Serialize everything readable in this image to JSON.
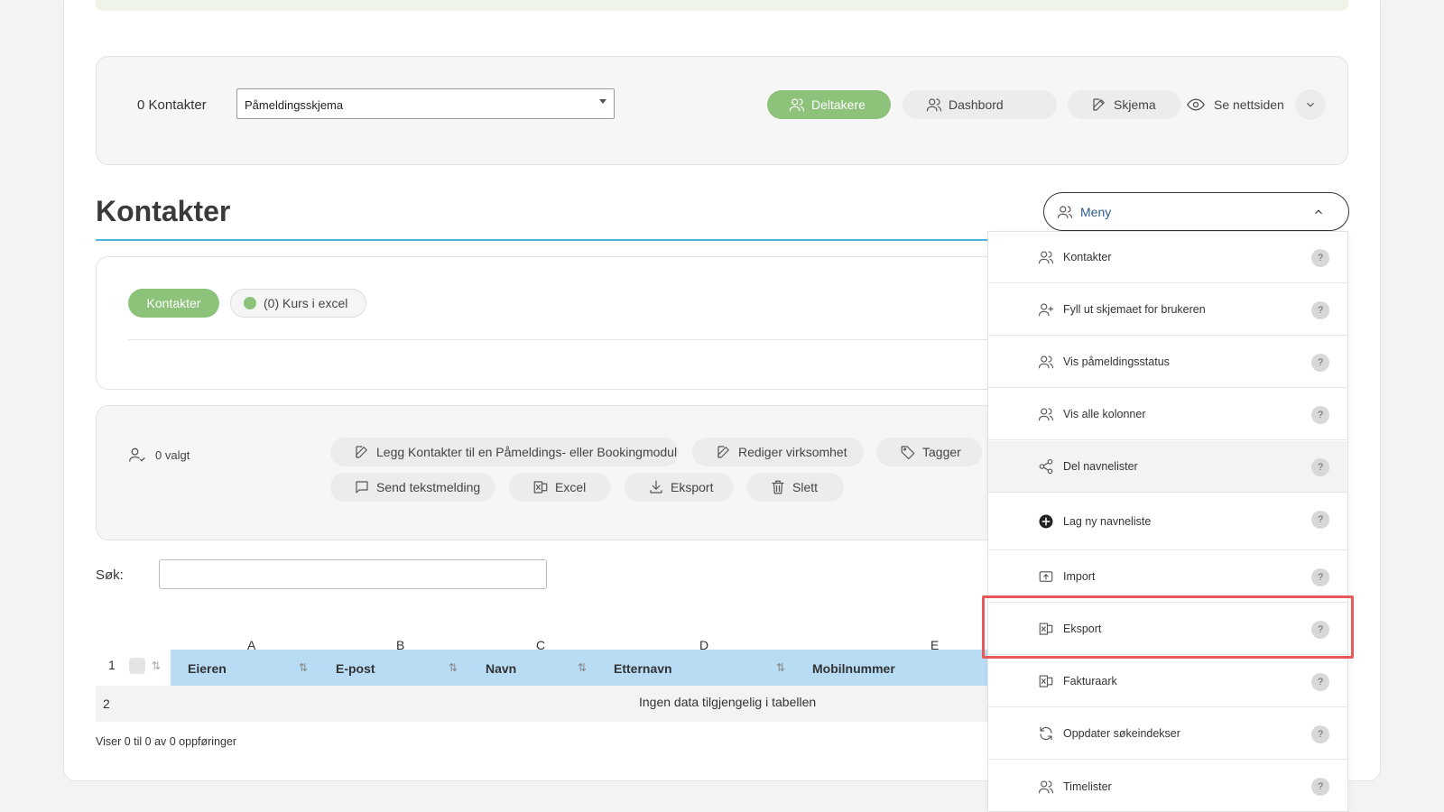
{
  "header": {
    "contacts_count": "0 Kontakter",
    "form_select": "Påmeldingsskjema",
    "tabs": [
      "Deltakere",
      "Dashbord",
      "Skjema"
    ],
    "view_site": "Se nettsiden"
  },
  "page_title": "Kontakter",
  "menu_button": "Meny",
  "pills": {
    "contacts": "Kontakter",
    "excel_list": "(0) Kurs i excel"
  },
  "actions": {
    "selected": "0 valgt",
    "add_to_module": "Legg Kontakter til en Påmeldings- eller Bookingmodul",
    "edit_company": "Rediger virksomhet",
    "tags": "Tagger",
    "send_sms": "Send tekstmelding",
    "excel": "Excel",
    "export": "Eksport",
    "delete": "Slett"
  },
  "search": {
    "label": "Søk:",
    "placeholder": ""
  },
  "table": {
    "col_letters": [
      "A",
      "B",
      "C",
      "D",
      "E"
    ],
    "headers": [
      "Eieren",
      "E-post",
      "Navn",
      "Etternavn",
      "Mobilnummer"
    ],
    "row_numbers": [
      "1",
      "2"
    ],
    "empty_text": "Ingen data tilgjengelig i tabellen",
    "info": "Viser 0 til 0 av 0 oppføringer"
  },
  "dropdown": {
    "items": [
      {
        "label": "Kontakter",
        "icon": "users-icon"
      },
      {
        "label": "Fyll ut skjemaet for brukeren",
        "icon": "user-plus-icon"
      },
      {
        "label": "Vis påmeldingsstatus",
        "icon": "users-icon"
      },
      {
        "label": "Vis alle kolonner",
        "icon": "users-icon"
      },
      {
        "label": "Del navnelister",
        "icon": "share-icon"
      },
      {
        "label": "Lag ny navneliste",
        "icon": "plus-circle-icon"
      },
      {
        "label": "Import",
        "icon": "upload-icon"
      },
      {
        "label": "Eksport",
        "icon": "excel-icon"
      },
      {
        "label": "Fakturaark",
        "icon": "excel-icon"
      },
      {
        "label": "Oppdater søkeindekser",
        "icon": "refresh-icon"
      },
      {
        "label": "Timelister",
        "icon": "users-icon"
      }
    ],
    "help": "?"
  },
  "colors": {
    "green": "#8cc27a",
    "blue_header": "#b9dcf5",
    "highlight": "#e85a5a",
    "title_line": "#4fb2dc"
  }
}
